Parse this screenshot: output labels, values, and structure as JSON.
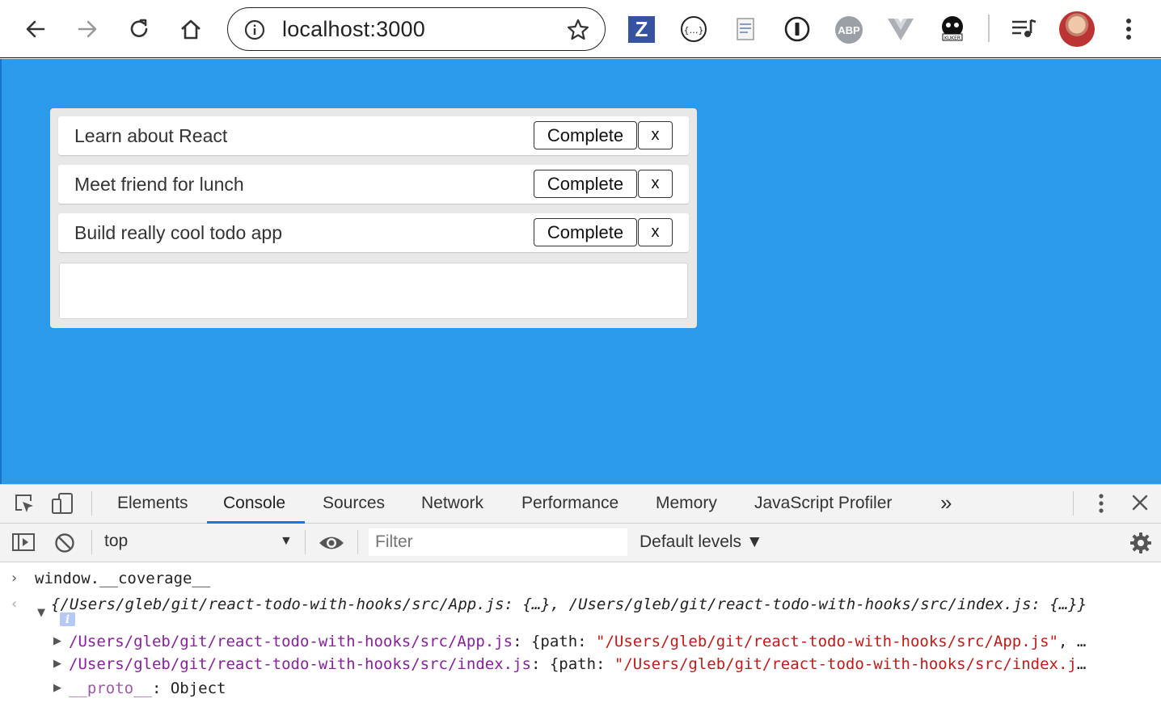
{
  "browser": {
    "url": "localhost:3000",
    "extensions": [
      "z-extension-icon",
      "json-viewer-icon",
      "notes-extension-icon",
      "1password-icon",
      "adblock-plus-icon",
      "vue-devtools-icon",
      "kuker-icon"
    ],
    "z_label": "Z",
    "abp_label": "ABP",
    "json_label": "{...}"
  },
  "todos": [
    {
      "text": "Learn about React",
      "complete_label": "Complete",
      "remove_label": "x"
    },
    {
      "text": "Meet friend for lunch",
      "complete_label": "Complete",
      "remove_label": "x"
    },
    {
      "text": "Build really cool todo app",
      "complete_label": "Complete",
      "remove_label": "x"
    }
  ],
  "new_todo": {
    "value": ""
  },
  "colors": {
    "page_background": "#2b9aea",
    "card_background": "#e8e8e8",
    "active_tab_accent": "#1a73e8"
  },
  "devtools": {
    "tabs": [
      "Elements",
      "Console",
      "Sources",
      "Network",
      "Performance",
      "Memory",
      "JavaScript Profiler"
    ],
    "active_tab": "Console",
    "more_tabs": "»",
    "context": "top",
    "filter_placeholder": "Filter",
    "levels": "Default levels ▼",
    "console": {
      "input": "window.__coverage__",
      "summary": "{/Users/gleb/git/react-todo-with-hooks/src/App.js: {…}, /Users/gleb/git/react-todo-with-hooks/src/index.js: {…}}",
      "info": "i",
      "entries": [
        {
          "key": "/Users/gleb/git/react-todo-with-hooks/src/App.js",
          "sep": ": {path: ",
          "value": "\"/Users/gleb/git/react-todo-with-hooks/src/App.js\"",
          "tail": ", …"
        },
        {
          "key": "/Users/gleb/git/react-todo-with-hooks/src/index.js",
          "sep": ": {path: ",
          "value": "\"/Users/gleb/git/react-todo-with-hooks/src/index.j",
          "tail": "…"
        },
        {
          "key": "__proto__",
          "sep": ": Object",
          "value": "",
          "tail": ""
        }
      ]
    }
  }
}
